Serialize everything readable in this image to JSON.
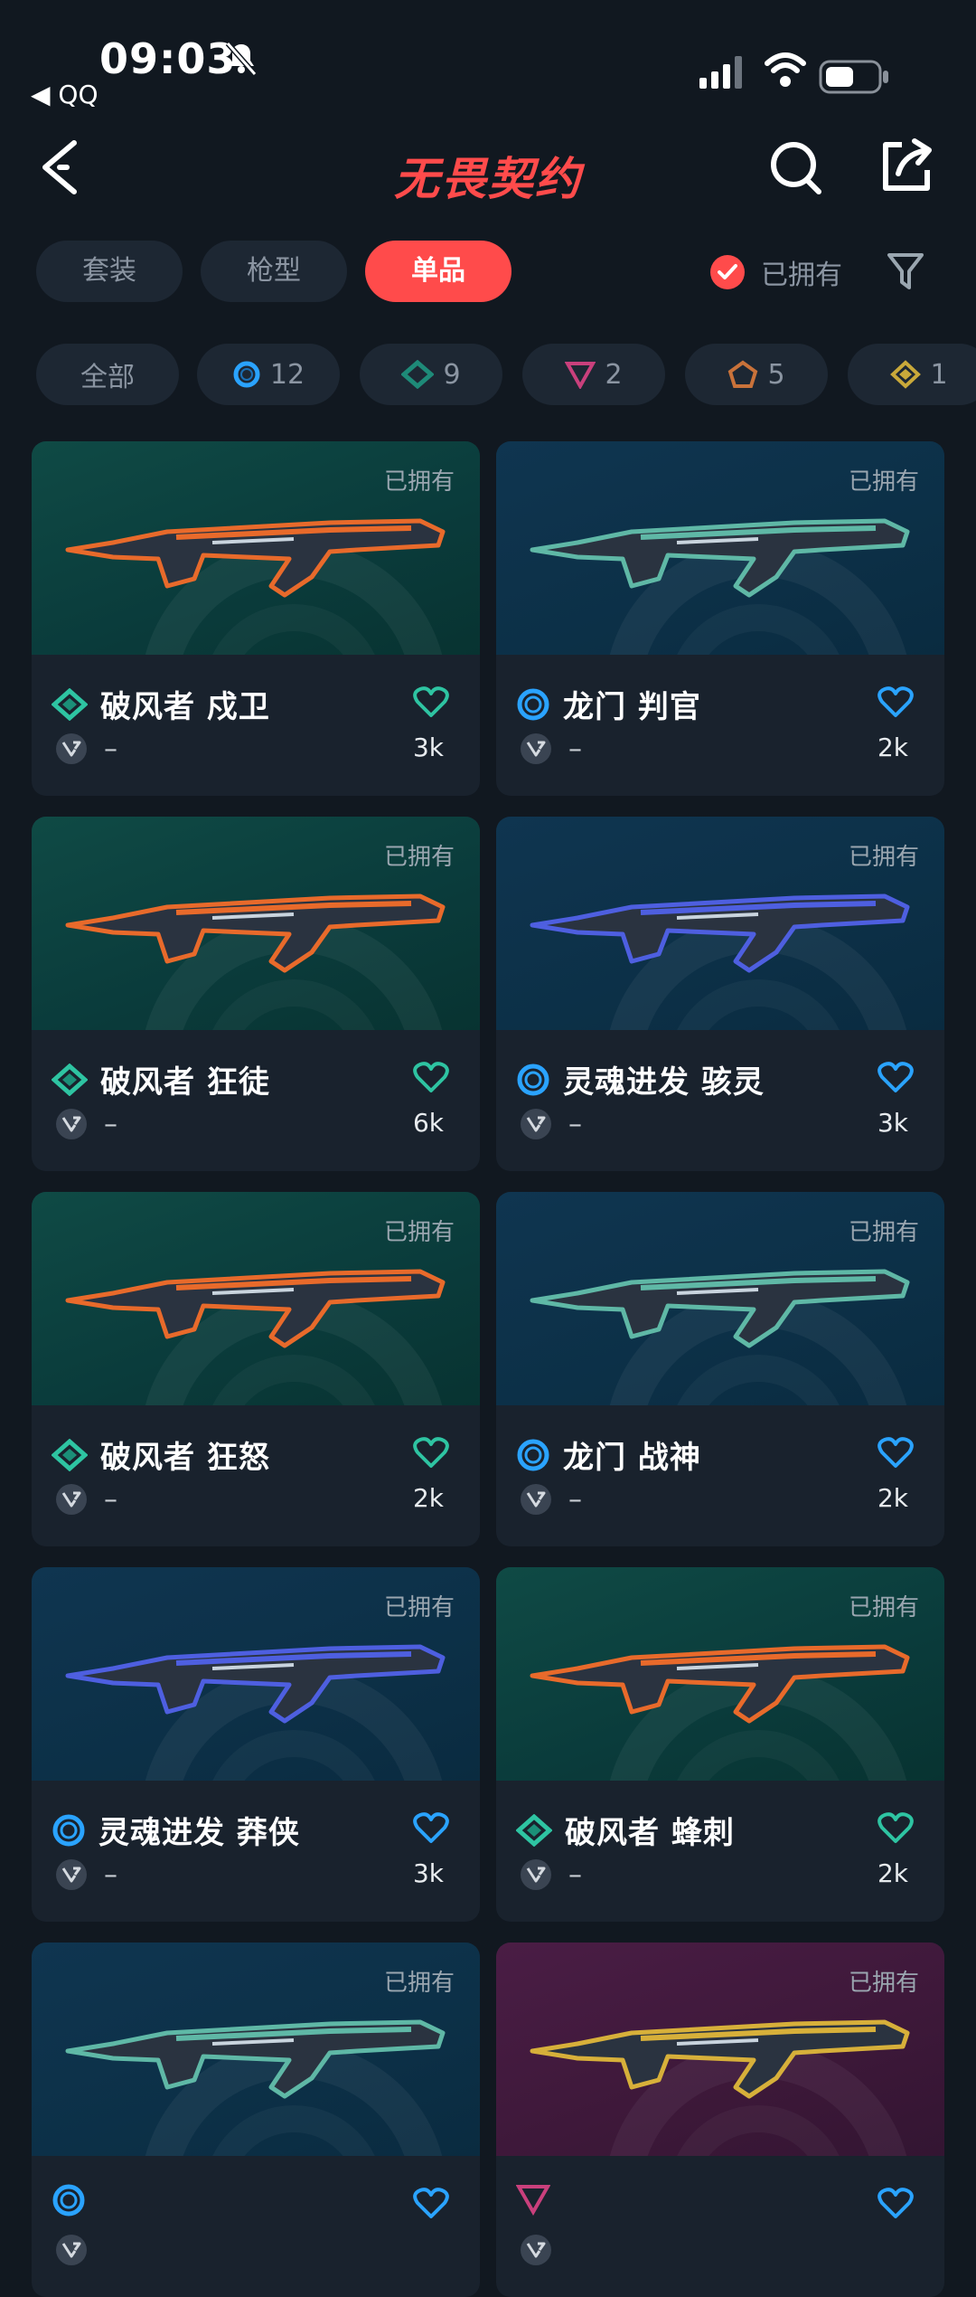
{
  "status_bar": {
    "time": "09:03",
    "back_app": "◀ QQ"
  },
  "header": {
    "logo_text": "无畏契约"
  },
  "tabs": [
    {
      "label": "套装",
      "active": false
    },
    {
      "label": "枪型",
      "active": false
    },
    {
      "label": "单品",
      "active": true
    }
  ],
  "owned_filter": {
    "label": "已拥有",
    "checked": true
  },
  "chips": [
    {
      "label": "全部",
      "icon": "none"
    },
    {
      "label": "12",
      "icon": "rarity-blue-ring-icon"
    },
    {
      "label": "9",
      "icon": "rarity-green-diamond-icon"
    },
    {
      "label": "2",
      "icon": "rarity-pink-triangle-icon"
    },
    {
      "label": "5",
      "icon": "rarity-orange-pentagon-icon"
    },
    {
      "label": "1",
      "icon": "rarity-gold-diamond-icon"
    }
  ],
  "cards": [
    {
      "owned": "已拥有",
      "name": "破风者 戍卫",
      "count": "3k",
      "dash": "–",
      "rarity": "green",
      "banner": "green",
      "accent": "#e86a2b"
    },
    {
      "owned": "已拥有",
      "name": "龙门 判官",
      "count": "2k",
      "dash": "–",
      "rarity": "blue",
      "banner": "blue",
      "accent": "#5fb8a6"
    },
    {
      "owned": "已拥有",
      "name": "破风者 狂徒",
      "count": "6k",
      "dash": "–",
      "rarity": "green",
      "banner": "green",
      "accent": "#e86a2b"
    },
    {
      "owned": "已拥有",
      "name": "灵魂进发 骇灵",
      "count": "3k",
      "dash": "–",
      "rarity": "blue",
      "banner": "blue",
      "accent": "#4e5fe0"
    },
    {
      "owned": "已拥有",
      "name": "破风者 狂怒",
      "count": "2k",
      "dash": "–",
      "rarity": "green",
      "banner": "green",
      "accent": "#e86a2b"
    },
    {
      "owned": "已拥有",
      "name": "龙门 战神",
      "count": "2k",
      "dash": "–",
      "rarity": "blue",
      "banner": "blue",
      "accent": "#5fb8a6"
    },
    {
      "owned": "已拥有",
      "name": "灵魂进发 莽侠",
      "count": "3k",
      "dash": "–",
      "rarity": "blue",
      "banner": "blue",
      "accent": "#4e5fe0"
    },
    {
      "owned": "已拥有",
      "name": "破风者 蜂刺",
      "count": "2k",
      "dash": "–",
      "rarity": "green",
      "banner": "green",
      "accent": "#e86a2b"
    },
    {
      "owned": "已拥有",
      "name": "",
      "count": "",
      "dash": "",
      "rarity": "blue",
      "banner": "blue",
      "accent": "#5fb8a6"
    },
    {
      "owned": "已拥有",
      "name": "",
      "count": "",
      "dash": "",
      "rarity": "purple",
      "banner": "purple",
      "accent": "#d7b03a"
    }
  ],
  "colors": {
    "accent": "#ff4b4b",
    "background": "#111820",
    "card": "#19222d",
    "green_rarity": "#2ec4a2",
    "blue_rarity": "#2aa3ff"
  }
}
